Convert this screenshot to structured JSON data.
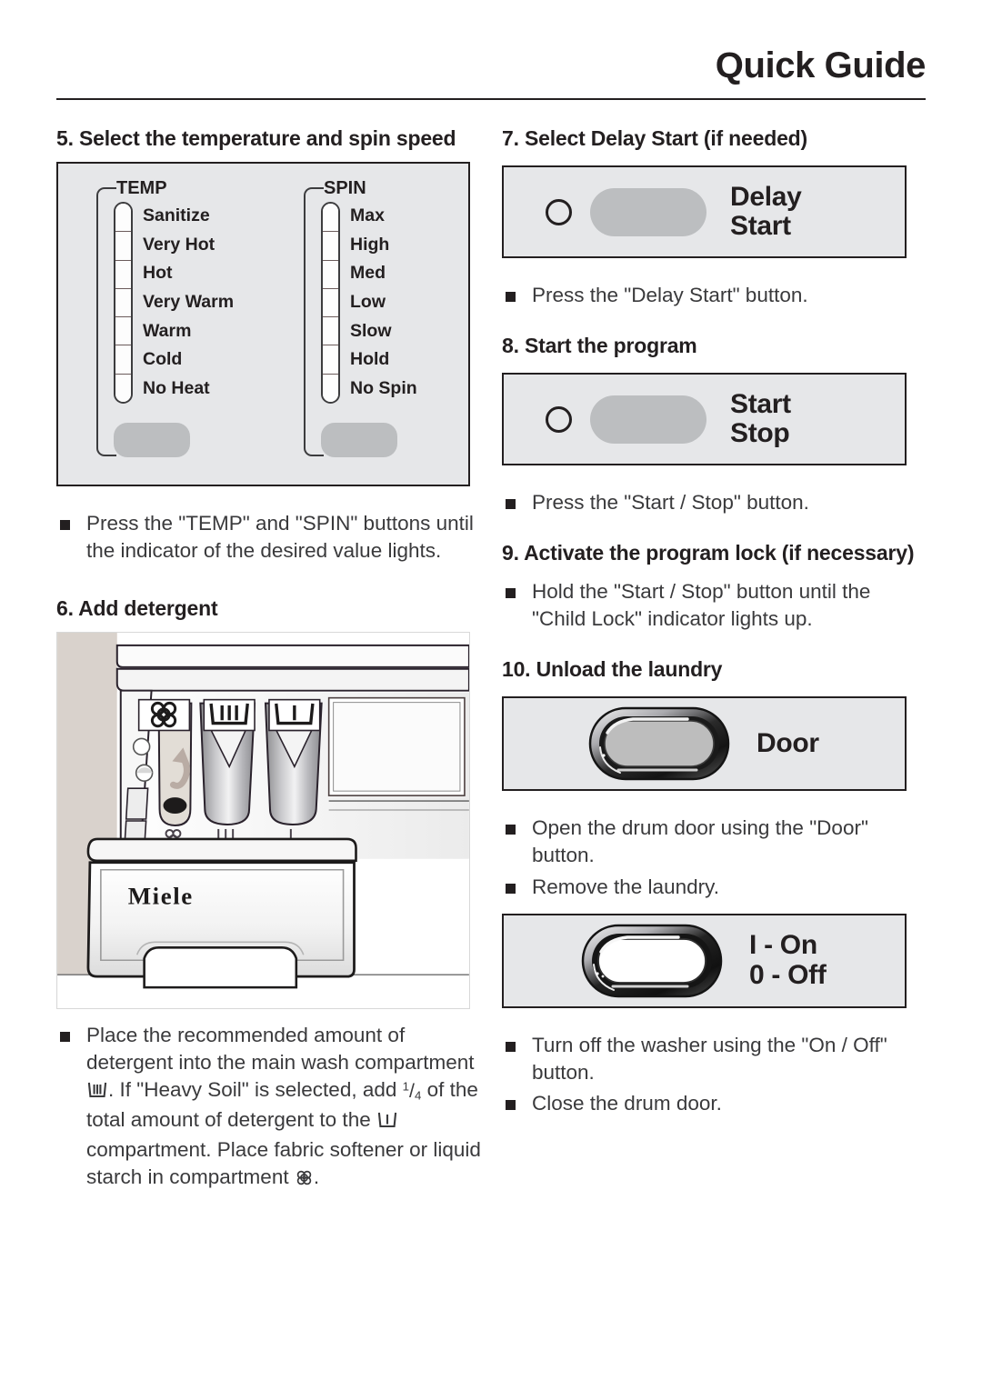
{
  "header": {
    "title": "Quick Guide"
  },
  "left_column": {
    "step5": {
      "heading": "5. Select the temperature and spin speed",
      "temp": {
        "label": "TEMP",
        "options": [
          "Sanitize",
          "Very Hot",
          "Hot",
          "Very Warm",
          "Warm",
          "Cold",
          "No Heat"
        ]
      },
      "spin": {
        "label": "SPIN",
        "options": [
          "Max",
          "High",
          "Med",
          "Low",
          "Slow",
          "Hold",
          "No Spin"
        ]
      },
      "bullets": [
        "Press the \"TEMP\" and \"SPIN\" buttons until the indicator of the desired value lights."
      ]
    },
    "step6": {
      "heading": "6. Add detergent",
      "brand": "Miele",
      "bullet_part1": "Place the recommended amount of detergent into the main wash compartment",
      "bullet_part2": ". If \"Heavy Soil\" is selected, add",
      "fraction_numerator": "1",
      "fraction_denominator": "4",
      "bullet_part3": "of the total amount of detergent to the",
      "bullet_part4": "compartment. Place fabric softener or liquid starch in compartment",
      "bullet_part5": "."
    }
  },
  "right_column": {
    "step7": {
      "heading": "7. Select Delay Start (if needed)",
      "button_caption_line1": "Delay",
      "button_caption_line2": "Start",
      "bullets": [
        "Press the \"Delay Start\" button."
      ]
    },
    "step8": {
      "heading": "8. Start the program",
      "button_caption_line1": "Start",
      "button_caption_line2": "Stop",
      "bullets": [
        "Press the \"Start / Stop\" button."
      ]
    },
    "step9": {
      "heading": "9. Activate the program lock (if necessary)",
      "bullets": [
        "Hold the \"Start / Stop\" button until the \"Child Lock\" indicator lights up."
      ]
    },
    "step10": {
      "heading": "10. Unload the laundry",
      "door_caption": "Door",
      "door_bullets": [
        "Open the drum door using the \"Door\" button.",
        "Remove the laundry."
      ],
      "power_caption_line1": "I - On",
      "power_caption_line2": "0 - Off",
      "power_bullets": [
        "Turn off the washer using the \"On / Off\" button.",
        "Close the drum door."
      ]
    }
  },
  "colors": {
    "panel_background": "#e6e7e9",
    "panel_border": "#231f20",
    "button_gray": "#bcbec0",
    "text": "#231f20",
    "body_text": "#3a3a3c"
  }
}
